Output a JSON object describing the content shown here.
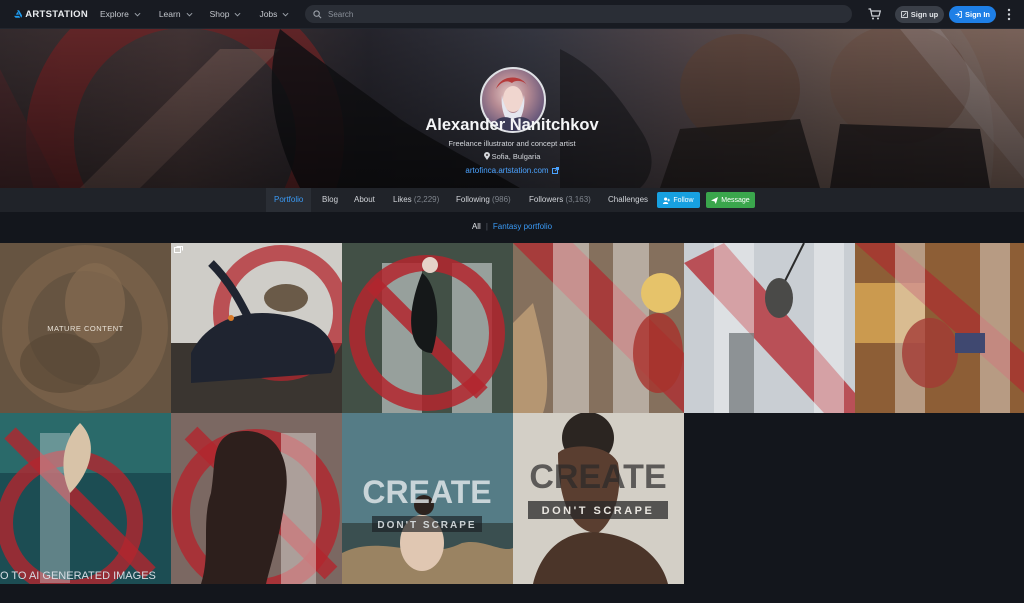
{
  "nav": {
    "logo_text": "ARTSTATION",
    "items": [
      {
        "label": "Explore"
      },
      {
        "label": "Learn"
      },
      {
        "label": "Shop"
      },
      {
        "label": "Jobs"
      }
    ],
    "search_placeholder": "Search",
    "signup_label": "Sign up",
    "signin_label": "Sign In"
  },
  "profile": {
    "name": "Alexander Nanitchkov",
    "headline": "Freelance illustrator and concept artist",
    "location": "Sofia, Bulgaria",
    "website": "artofinca.artstation.com"
  },
  "tabs": {
    "portfolio": "Portfolio",
    "blog": "Blog",
    "about": "About",
    "likes": "Likes",
    "likes_count": "(2,229)",
    "following": "Following",
    "following_count": "(986)",
    "followers": "Followers",
    "followers_count": "(3,163)",
    "challenges": "Challenges",
    "follow_label": "Follow",
    "message_label": "Message"
  },
  "albums": {
    "all": "All",
    "separator": "|",
    "fantasy": "Fantasy portfolio"
  },
  "grid": {
    "mature_label": "MATURE CONTENT",
    "create_line1": "CREATE",
    "create_line2": "DON'T SCRAPE",
    "caption_text": "O TO AI GENERATED IMAGES"
  },
  "colors": {
    "accent": "#3a9af5",
    "signin": "#1e7fe6",
    "follow": "#17a0e0",
    "message": "#3aa64c",
    "no_ai_red": "#b3262e"
  },
  "icons": [
    "artstation-logo-icon",
    "chevron-down-icon",
    "search-icon",
    "cart-icon",
    "signup-icon",
    "signin-icon",
    "more-vertical-icon",
    "location-pin-icon",
    "external-link-icon",
    "follow-user-icon",
    "message-icon",
    "multiple-images-icon"
  ]
}
